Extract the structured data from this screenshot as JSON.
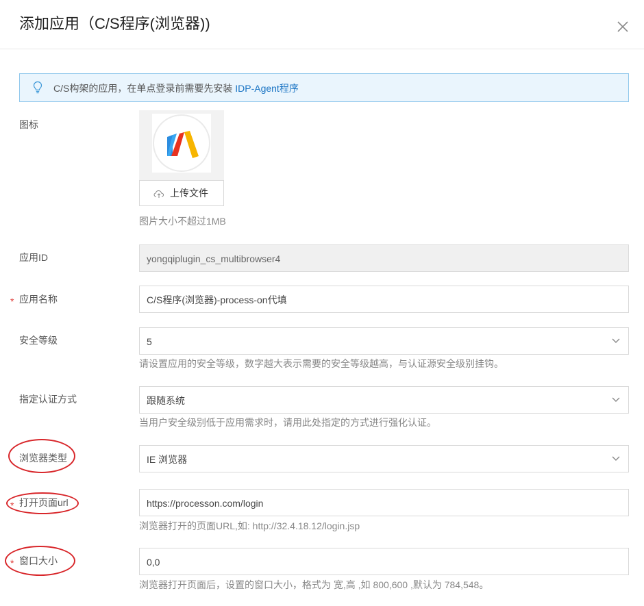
{
  "dialog": {
    "title": "添加应用（C/S程序(浏览器))"
  },
  "notice": {
    "text": "C/S构架的应用，在单点登录前需要先安装",
    "link": " IDP-Agent程序"
  },
  "icon_field": {
    "label": "图标",
    "upload_label": "上传文件",
    "hint": "图片大小不超过1MB"
  },
  "app_id": {
    "label": "应用ID",
    "value": "yongqiplugin_cs_multibrowser4"
  },
  "app_name": {
    "required_mark": "*",
    "label": "应用名称",
    "value": "C/S程序(浏览器)-process-on代填"
  },
  "security_level": {
    "label": "安全等级",
    "value": "5",
    "hint": "请设置应用的安全等级，数字越大表示需要的安全等级越高，与认证源安全级别挂钩。"
  },
  "auth_method": {
    "label": "指定认证方式",
    "value": "跟随系统",
    "hint": "当用户安全级别低于应用需求时，请用此处指定的方式进行强化认证。"
  },
  "browser_type": {
    "label": "浏览器类型",
    "value": "IE 浏览器"
  },
  "open_url": {
    "required_mark": "*",
    "label": "打开页面url",
    "value": "https://processon.com/login",
    "hint": "浏览器打开的页面URL,如: http://32.4.18.12/login.jsp"
  },
  "window_size": {
    "required_mark": "*",
    "label": "窗口大小",
    "value": "0,0",
    "hint": "浏览器打开页面后，设置的窗口大小，格式为 宽,高 ,如 800,600 ,默认为 784,548。"
  },
  "colors": {
    "accent": "#1a74c4",
    "required": "#e0403c",
    "annotation": "#d8262a",
    "notice_bg": "#eaf5fd"
  }
}
